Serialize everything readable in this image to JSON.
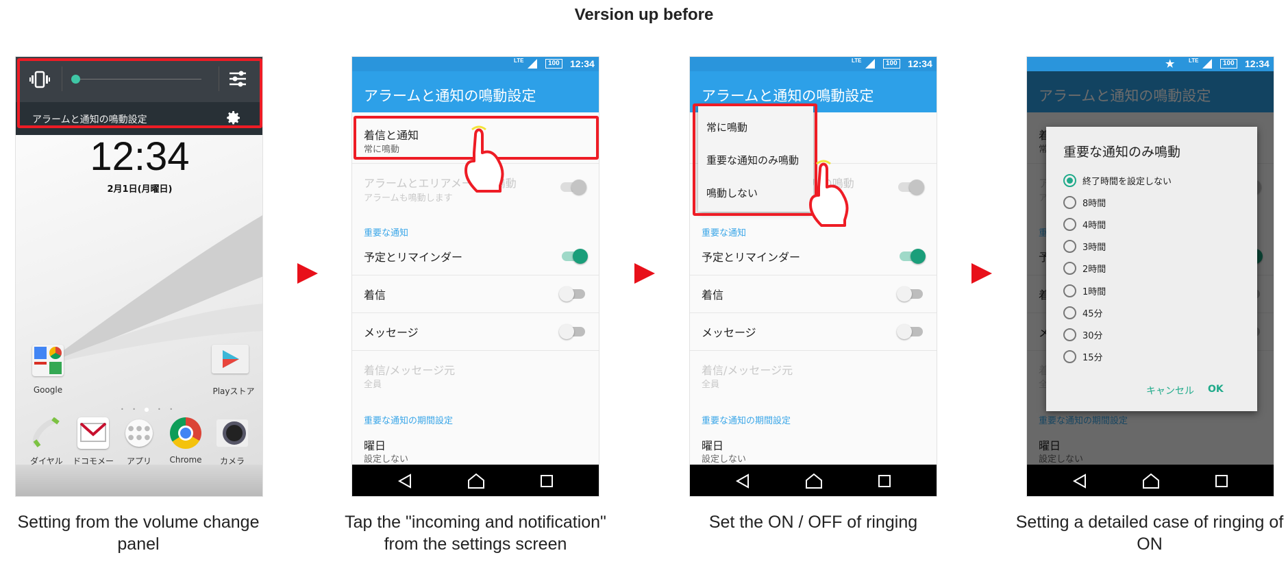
{
  "title": "Version up before",
  "colors": {
    "accent_red": "#ee1c25",
    "app_bar": "#2da0e8",
    "toggle_on": "#1a9e7a",
    "dialog_accent": "#1faa8a",
    "section_header": "#3aa6e8"
  },
  "status_bar": {
    "network": "LTE",
    "battery": "100",
    "time": "12:34"
  },
  "steps": [
    {
      "caption": "Setting from the volume change panel"
    },
    {
      "caption": "Tap the \"incoming and notification\" from the settings screen"
    },
    {
      "caption": "Set the ON / OFF of ringing"
    },
    {
      "caption": "Setting a detailed case of ringing of ON"
    }
  ],
  "home": {
    "panel_label": "アラームと通知の鳴動設定",
    "volume_level": 0.0,
    "clock": "12:34",
    "date": "2月1日(月曜日)",
    "apps": [
      {
        "label": "Google",
        "icon": "google-folder-icon"
      },
      {
        "label": "Playストア",
        "icon": "play-store-icon"
      }
    ],
    "dock": [
      {
        "label": "ダイヤル",
        "icon": "phone-icon"
      },
      {
        "label": "ドコモメー",
        "icon": "mail-icon"
      },
      {
        "label": "アプリ",
        "icon": "apps-icon"
      },
      {
        "label": "Chrome",
        "icon": "chrome-icon"
      },
      {
        "label": "カメラ",
        "icon": "camera-icon"
      }
    ]
  },
  "settings": {
    "app_title": "アラームと通知の鳴動設定",
    "incoming": {
      "title": "着信と通知",
      "value": "常に鳴動"
    },
    "alarm": {
      "title": "アラームとエリアメールの鳴動",
      "sub": "アラームも鳴動します",
      "on": true,
      "disabled": true
    },
    "section_important": "重要な通知",
    "toggles": [
      {
        "label": "予定とリマインダー",
        "on": true
      },
      {
        "label": "着信",
        "on": false
      },
      {
        "label": "メッセージ",
        "on": false
      }
    ],
    "source": {
      "title": "着信/メッセージ元",
      "value": "全員",
      "disabled": true
    },
    "section_period": "重要な通知の期間設定",
    "day": {
      "title": "曜日",
      "value": "設定しない"
    }
  },
  "menu": {
    "items": [
      "常に鳴動",
      "重要な通知のみ鳴動",
      "鳴動しない"
    ]
  },
  "dialog": {
    "title": "重要な通知のみ鳴動",
    "options": [
      "終了時間を設定しない",
      "8時間",
      "4時間",
      "3時間",
      "2時間",
      "1時間",
      "45分",
      "30分",
      "15分"
    ],
    "selected": 0,
    "cancel": "キャンセル",
    "ok": "OK"
  }
}
